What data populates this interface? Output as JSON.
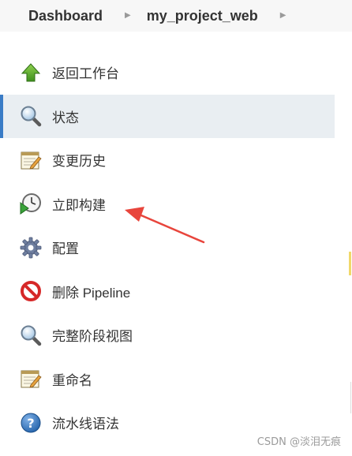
{
  "breadcrumb": {
    "items": [
      "Dashboard",
      "my_project_web"
    ]
  },
  "sidebar": {
    "items": [
      {
        "label": "返回工作台",
        "icon": "up-arrow-icon"
      },
      {
        "label": "状态",
        "icon": "search-icon",
        "active": true
      },
      {
        "label": "变更历史",
        "icon": "notepad-icon"
      },
      {
        "label": "立即构建",
        "icon": "build-clock-icon"
      },
      {
        "label": "配置",
        "icon": "gear-icon"
      },
      {
        "label": "删除 Pipeline",
        "icon": "no-entry-icon"
      },
      {
        "label": "完整阶段视图",
        "icon": "search-icon"
      },
      {
        "label": "重命名",
        "icon": "notepad-icon"
      },
      {
        "label": "流水线语法",
        "icon": "help-icon"
      }
    ]
  },
  "annotation": {
    "color": "#e8453c"
  },
  "watermark": "CSDN @淡泪无痕"
}
